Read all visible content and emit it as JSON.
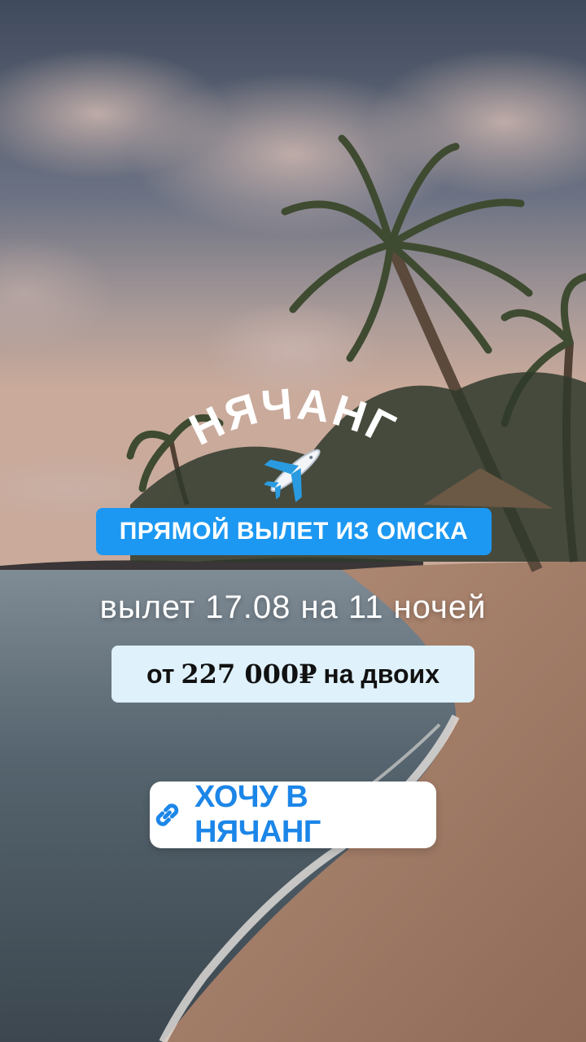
{
  "story": {
    "destination_title": "НЯЧАНГ",
    "plane_icon": "airplane-icon",
    "badge_text": "ПРЯМОЙ ВЫЛЕТ ИЗ ОМСКА",
    "departure_text": "вылет 17.08 на 11 ночей",
    "price": {
      "prefix": "от",
      "amount": "227 000₽",
      "suffix": "на двоих"
    },
    "cta": {
      "icon": "link-icon",
      "label": "ХОЧУ В НЯЧАНГ"
    }
  },
  "colors": {
    "accent_blue": "#1c98f2",
    "price_bg": "#dff1fb",
    "cta_text": "#1c86e8"
  }
}
